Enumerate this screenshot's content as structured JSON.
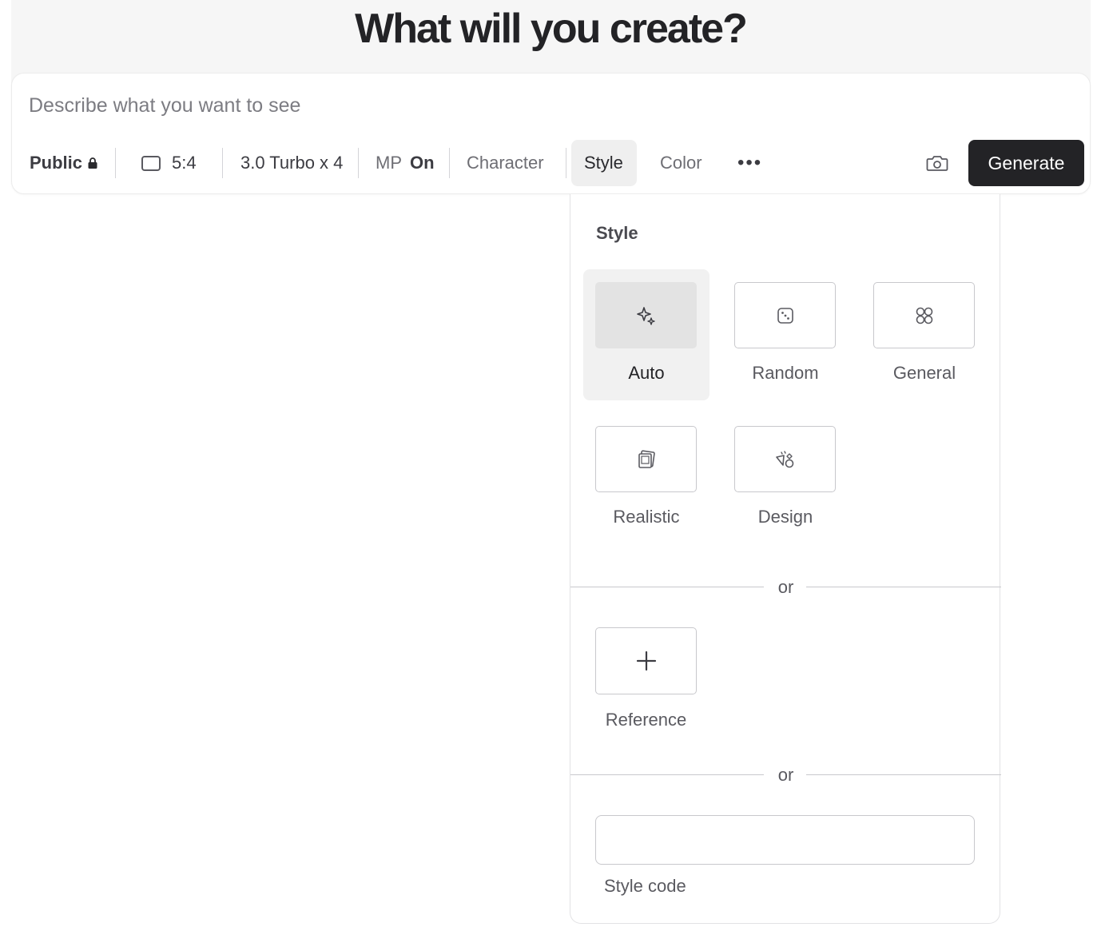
{
  "header": {
    "title": "What will you create?"
  },
  "prompt": {
    "placeholder": "Describe what you want to see",
    "value": ""
  },
  "toolbar": {
    "visibility_label": "Public",
    "aspect_ratio": "5:4",
    "model": "3.0 Turbo",
    "count": "x 4",
    "mp_label": "MP",
    "mp_value": "On",
    "character_label": "Character",
    "style_label": "Style",
    "color_label": "Color",
    "more_label": "•••",
    "generate_label": "Generate"
  },
  "style_panel": {
    "title": "Style",
    "options": [
      {
        "label": "Auto",
        "icon": "sparkle-icon",
        "selected": true
      },
      {
        "label": "Random",
        "icon": "dice-icon",
        "selected": false
      },
      {
        "label": "General",
        "icon": "command-icon",
        "selected": false
      },
      {
        "label": "Realistic",
        "icon": "photos-icon",
        "selected": false
      },
      {
        "label": "Design",
        "icon": "shapes-icon",
        "selected": false
      }
    ],
    "or_1": "or",
    "reference_label": "Reference",
    "or_2": "or",
    "style_code_label": "Style code",
    "style_code_value": ""
  },
  "colors": {
    "accent_dark": "#232326",
    "active_bg": "#efefef",
    "header_bg": "#f6f6f6"
  }
}
